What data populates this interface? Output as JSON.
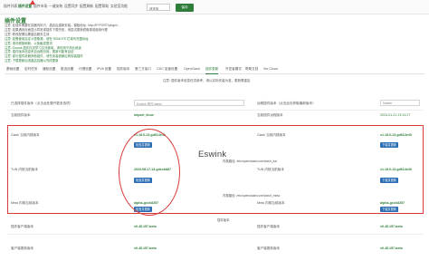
{
  "nav": {
    "items": [
      "插件列表",
      "插件设置",
      "插件市场",
      "一键安装",
      "设置同步",
      "配置刷新",
      "配置帮助",
      "实验室功能"
    ],
    "select_value": "请选择",
    "save_label": "保存"
  },
  "page": {
    "title": "插件设置",
    "notes": [
      "注意: 此插件需要在容器内执行，重启后重新安装。模板地址: http://IP:PORT/plugin/...",
      "注意: 如果遇到页面显示异常或插件下载失败，请尝试更换镜像源或使用代理",
      "注意: 修改配置后需重启服务生效",
      "注意: 如需使用自定义镜像源，请在 REMOTE 栏填写完整地址",
      "注意: 请勿频繁刷新，以免触发限流",
      "注意: Eswink 插件仅供学习交流使用，请勿用于商业用途",
      "注意: 插件版本信息来自远程仓库，更新可能有延迟",
      "注意: 部分插件依赖其他组件，请先安装依赖后再安装插件",
      "注意: 下载更新后请重启容器以完成更新"
    ]
  },
  "tabs": [
    "基础设置",
    "定时任务",
    "通知设置",
    "推送设置",
    "代理设置",
    "IPV6 设置",
    "插件版本",
    "第三方接口",
    "CDC 加速设置",
    "OpenClash",
    "插件更新",
    "开发者模式",
    "帮助文档",
    "Ver Cloud"
  ],
  "hint": "注意: 插件版本信息仅供参考，请以实际安装为准，更新需重启",
  "rows": [
    {
      "label": "已选择插件版本（点击此处展开更多选项）",
      "select": "Eswink 插件 latest",
      "right_label": "远程插件版本（点击此处获取最新版本）",
      "right_value": "Master"
    },
    {
      "label": "当前插件版本",
      "value": "mipsel_linux",
      "right_label": "当前插件远程版本",
      "right_value": "2024-01-21 23:14:27"
    }
  ],
  "packages": [
    {
      "left_label": "Clash 当前内核版本",
      "left_value": "v1.18.0-13-gd614e40",
      "left_button": "检查并更新",
      "right_label": "Clash 当前内核版本",
      "right_value": "v1.18.0-13-gd614e40",
      "right_button": "下载并更新",
      "path": "内核路径: /etc/openclash/core/clash_tun"
    },
    {
      "left_label": "TUN 内核当前版本",
      "left_value": "2023.08.17-13-gdcc8d87",
      "left_button": "检查并更新",
      "right_label": "TUN 内核当前版本",
      "right_value": "v1.18.0-13-gd614e40",
      "right_button": "下载并更新",
      "path": "内核路径: /etc/openclash/core/clash_meta"
    },
    {
      "left_label": "Meta 内核当前版本",
      "left_value": "alpha-gcc6d257",
      "left_button": "检查并更新",
      "right_label": "Meta 内核当前版本",
      "right_value": "alpha-gcc6d257",
      "right_button": "下载并更新",
      "path": ""
    }
  ],
  "footer": {
    "center": "插件版本",
    "left_label": "插件客户端版本",
    "left_value": "v0.45.157-beta",
    "right_label": "插件客户端版本",
    "right_value": "v0.45.157-beta",
    "left_label2": "客户端更新版本",
    "left_value2": "v0.45.157-beta",
    "right_label2": "客户端更新版本",
    "right_value2": "v0.45.157-beta"
  },
  "overlay": {
    "watermark": "Eswink"
  },
  "colors": {
    "accent": "#2e7d3a",
    "button": "#2a6db3",
    "annotation": "#d93a3a"
  }
}
